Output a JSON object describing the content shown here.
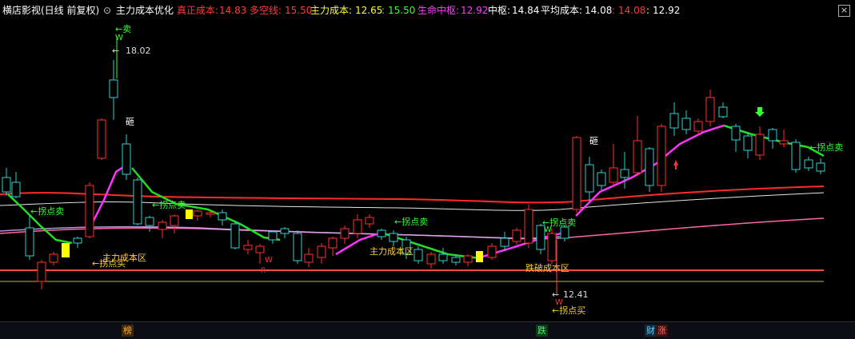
{
  "header": {
    "stock_name": "横店影视(日线 前复权)",
    "indicator_name": "主力成本优化",
    "items": [
      {
        "label": "真正成本:",
        "value": "14.83",
        "color": "#ff3b3b"
      },
      {
        "label": "多空线:",
        "value": "15.50",
        "color": "#ff3b3b"
      },
      {
        "label": "主力成本:",
        "value": "12.65",
        "color": "#ffff3b"
      },
      {
        "label": ":",
        "value": "15.50",
        "color": "#3bff3b"
      },
      {
        "label": "生命中枢:",
        "value": "12.92",
        "color": "#ff3bff"
      },
      {
        "label": "中枢:",
        "value": "14.84",
        "color": "#ffffff"
      },
      {
        "label": "平均成本:",
        "value": "14.08",
        "color": "#ffffff"
      },
      {
        "label": ":",
        "value": "14.08",
        "color": "#ff3b3b"
      },
      {
        "label": ":",
        "value": "12.92",
        "color": "#ffffff"
      }
    ],
    "close_label": "×"
  },
  "annotations": {
    "high_price": "18.02",
    "low_price": "12.41",
    "sell_arrow_label": "←卖",
    "w_mark": "W",
    "r_mark": "R",
    "hammer_label": "砸",
    "turn_sell": "←拐点卖",
    "turn_buy": "←拐点买",
    "main_cost_zone": "主力成本区",
    "drop_cost_zone": "跌破成本区"
  },
  "bottom_markers": [
    {
      "label": "榜",
      "color": "#ffaa33",
      "bg": "#3a2a10"
    },
    {
      "label": "跌",
      "color": "#33ff66",
      "bg": "#103a18"
    },
    {
      "label": "财",
      "color": "#66ccff",
      "bg": "#102a3a"
    },
    {
      "label": "涨",
      "color": "#ff6666",
      "bg": "#3a1010"
    }
  ],
  "colors": {
    "up": "#ff3030",
    "down": "#30d0d0",
    "yellow_box": "#ffff00",
    "background": "#000000"
  }
}
